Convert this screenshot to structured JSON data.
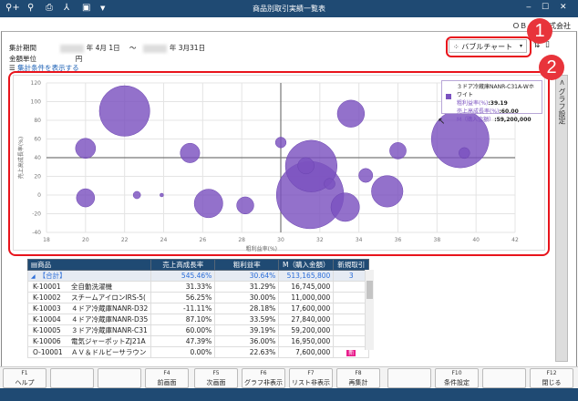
{
  "window": {
    "title": "商品別取引実績一覧表",
    "company": "ＯＢ　　　式会社",
    "minimize": "‒",
    "maximize": "☐",
    "close": "✕"
  },
  "toolbar_icons": [
    "zoom-in-icon",
    "zoom-search-icon",
    "print-icon",
    "pdf-icon",
    "excel-icon",
    "dropdown-icon"
  ],
  "header": {
    "period_label": "集計期間",
    "period_start": "年 4月 1日",
    "tilde": "～",
    "period_end": "年 3月31日",
    "unit_label": "金額単位",
    "unit_value": "円",
    "show_conditions": "集計条件を表示する",
    "chart_type": "バブルチャート",
    "side_tab": "グラフ設定",
    "side_tab_arrow": "<"
  },
  "annotations": [
    "1",
    "2"
  ],
  "tooltip": {
    "title": "３ドア冷蔵庫NANR-C31A-Wホワイト",
    "l1k": "粗利益率(%)",
    "l1v": ":39.19",
    "l2k": "売上高成長率(%)",
    "l2v": ":60.00",
    "l3k": "M（購入金額）",
    "l3v": ":59,200,000"
  },
  "chart_data": {
    "type": "bubble",
    "xlabel": "粗利益率(%)",
    "ylabel": "売上高成長率(%)",
    "xlim": [
      18,
      42
    ],
    "ylim": [
      -40,
      120
    ],
    "xticks": [
      18,
      20,
      22,
      24,
      26,
      28,
      30,
      32,
      34,
      36,
      38,
      40,
      42
    ],
    "yticks": [
      -40,
      -20,
      0,
      20,
      40,
      60,
      80,
      100,
      120
    ],
    "reference_x": 30,
    "reference_y": 40,
    "color": "#7b52c0",
    "points": [
      {
        "x": 20,
        "y": 50,
        "size": 20600000
      },
      {
        "x": 22,
        "y": 90,
        "size": 51800000
      },
      {
        "x": 20,
        "y": -3,
        "size": 18700000
      },
      {
        "x": 22.63,
        "y": 0,
        "size": 7600000
      },
      {
        "x": 23.9,
        "y": 0,
        "size": 3700000
      },
      {
        "x": 25.35,
        "y": 45,
        "size": 20000000
      },
      {
        "x": 26.3,
        "y": -9,
        "size": 29300000
      },
      {
        "x": 28.18,
        "y": -11.11,
        "size": 17600000
      },
      {
        "x": 30,
        "y": 56.25,
        "size": 11000000
      },
      {
        "x": 31.5,
        "y": 0,
        "size": 69000000
      },
      {
        "x": 31.56,
        "y": 31,
        "size": 53000000
      },
      {
        "x": 31.29,
        "y": 31.33,
        "size": 16745000
      },
      {
        "x": 32.5,
        "y": 12,
        "size": 11200000
      },
      {
        "x": 33.3,
        "y": -13,
        "size": 29300000
      },
      {
        "x": 33.59,
        "y": 87.1,
        "size": 27840000
      },
      {
        "x": 34.35,
        "y": 21,
        "size": 14400000
      },
      {
        "x": 35.45,
        "y": 4,
        "size": 32300000
      },
      {
        "x": 36,
        "y": 47.39,
        "size": 16950000
      },
      {
        "x": 39.19,
        "y": 60,
        "size": 59200000
      },
      {
        "x": 39.4,
        "y": 45,
        "size": 11200000
      }
    ]
  },
  "table": {
    "headers": [
      "商品",
      "売上高成長率",
      "粗利益率",
      "M（購入金額）",
      "新規取引"
    ],
    "total": {
      "label": "【合計】",
      "growth": "545.46%",
      "margin": "30.64%",
      "amount": "513,165,800",
      "new": "3"
    },
    "rows": [
      {
        "code": "K-10001",
        "name": "全自動洗濯機",
        "growth": "31.33%",
        "margin": "31.29%",
        "amount": "16,745,000",
        "new": ""
      },
      {
        "code": "K-10002",
        "name": "スチームアイロンIRS-5(",
        "growth": "56.25%",
        "margin": "30.00%",
        "amount": "11,000,000",
        "new": ""
      },
      {
        "code": "K-10003",
        "name": "４ドア冷蔵庫NANR-D32",
        "growth": "-11.11%",
        "margin": "28.18%",
        "amount": "17,600,000",
        "new": ""
      },
      {
        "code": "K-10004",
        "name": "４ドア冷蔵庫NANR-D35",
        "growth": "87.10%",
        "margin": "33.59%",
        "amount": "27,840,000",
        "new": ""
      },
      {
        "code": "K-10005",
        "name": "３ドア冷蔵庫NANR-C31",
        "growth": "60.00%",
        "margin": "39.19%",
        "amount": "59,200,000",
        "new": ""
      },
      {
        "code": "K-10006",
        "name": "電気ジャーポットZJ21A",
        "growth": "47.39%",
        "margin": "36.00%",
        "amount": "16,950,000",
        "new": ""
      },
      {
        "code": "O-10001",
        "name": "ＡＶ＆ドルビーサラウン",
        "growth": "0.00%",
        "margin": "22.63%",
        "amount": "7,600,000",
        "new": "新"
      }
    ]
  },
  "fkeys": [
    {
      "key": "F1",
      "label": "ヘルプ"
    },
    {
      "key": "",
      "label": ""
    },
    {
      "key": "",
      "label": ""
    },
    {
      "key": "F4",
      "label": "前画面"
    },
    {
      "key": "F5",
      "label": "次画面"
    },
    {
      "key": "F6",
      "label": "グラフ非表示"
    },
    {
      "key": "F7",
      "label": "リスト非表示"
    },
    {
      "key": "F8",
      "label": "再集計"
    },
    {
      "key": "",
      "label": ""
    },
    {
      "key": "F10",
      "label": "条件設定"
    },
    {
      "key": "",
      "label": ""
    },
    {
      "key": "F12",
      "label": "閉じる"
    }
  ]
}
